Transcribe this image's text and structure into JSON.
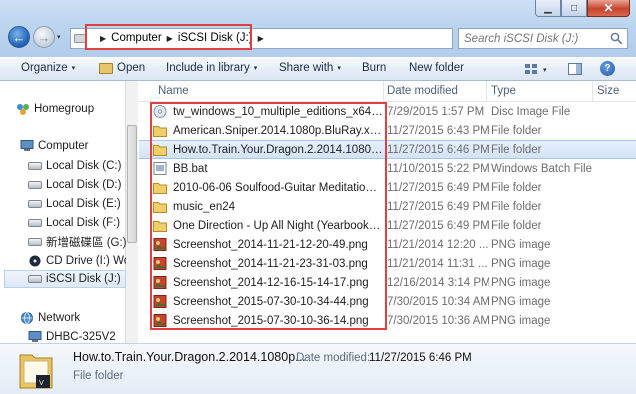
{
  "window": {
    "minimize_glyph": "▁",
    "maximize_glyph": "□",
    "close_glyph": "✕"
  },
  "nav_buttons": {
    "back_glyph": "←",
    "forward_glyph": "→",
    "dropdown_glyph": "▾"
  },
  "address": {
    "crumbs": [
      "Computer",
      "iSCSI Disk (J:)"
    ],
    "separator": "▶",
    "dropdown_glyph": "▾"
  },
  "search": {
    "placeholder": "Search iSCSI Disk (J:)"
  },
  "toolbar": {
    "organize_label": "Organize",
    "open_label": "Open",
    "include_label": "Include in library",
    "share_label": "Share with",
    "burn_label": "Burn",
    "newfolder_label": "New folder",
    "caret": "▾",
    "help_glyph": "?"
  },
  "sidebar": {
    "items": [
      {
        "label": "Homegroup",
        "icon": "homegroup-icon"
      },
      {
        "label": "Computer",
        "icon": "computer-icon"
      },
      {
        "label": "Local Disk (C:)",
        "icon": "drive-icon"
      },
      {
        "label": "Local Disk (D:)",
        "icon": "drive-icon"
      },
      {
        "label": "Local Disk (E:)",
        "icon": "drive-icon"
      },
      {
        "label": "Local Disk (F:)",
        "icon": "drive-icon"
      },
      {
        "label": "新增磁碟區 (G:)",
        "icon": "drive-icon"
      },
      {
        "label": "CD Drive (I:) Wor",
        "icon": "cd-drive-icon"
      },
      {
        "label": "iSCSI Disk (J:)",
        "icon": "drive-icon"
      },
      {
        "label": "Network",
        "icon": "network-icon"
      },
      {
        "label": "DHBC-325V2",
        "icon": "computer-icon"
      }
    ]
  },
  "columns": {
    "name": "Name",
    "date": "Date modified",
    "type": "Type",
    "size": "Size"
  },
  "files": [
    {
      "name": "tw_windows_10_multiple_editions_x64_dvd_...",
      "date": "7/29/2015 1:57 PM",
      "type": "Disc Image File",
      "icon": "disc-image-icon"
    },
    {
      "name": "American.Sniper.2014.1080p.BluRay.x264.DTS",
      "date": "11/27/2015 6:43 PM",
      "type": "File folder",
      "icon": "folder-icon"
    },
    {
      "name": "How.to.Train.Your.Dragon.2.2014.1080p.BluRay",
      "date": "11/27/2015 6:46 PM",
      "type": "File folder",
      "icon": "folder-icon"
    },
    {
      "name": "BB.bat",
      "date": "11/10/2015 5:22 PM",
      "type": "Windows Batch File",
      "icon": "batch-file-icon"
    },
    {
      "name": "2010-06-06 Soulfood-Guitar Meditations...",
      "date": "11/27/2015 6:49 PM",
      "type": "File folder",
      "icon": "folder-icon"
    },
    {
      "name": "music_en24",
      "date": "11/27/2015 6:49 PM",
      "type": "File folder",
      "icon": "folder-icon"
    },
    {
      "name": "One Direction - Up All Night (Yearbook Edition)",
      "date": "11/27/2015 6:49 PM",
      "type": "File folder",
      "icon": "folder-icon"
    },
    {
      "name": "Screenshot_2014-11-21-12-20-49.png",
      "date": "11/21/2014 12:20 ...",
      "type": "PNG image",
      "icon": "png-image-icon"
    },
    {
      "name": "Screenshot_2014-11-21-23-31-03.png",
      "date": "11/21/2014 11:31 ...",
      "type": "PNG image",
      "icon": "png-image-icon"
    },
    {
      "name": "Screenshot_2014-12-16-15-14-17.png",
      "date": "12/16/2014 3:14 PM",
      "type": "PNG image",
      "icon": "png-image-icon"
    },
    {
      "name": "Screenshot_2015-07-30-10-34-44.png",
      "date": "7/30/2015 10:34 AM",
      "type": "PNG image",
      "icon": "png-image-icon"
    },
    {
      "name": "Screenshot_2015-07-30-10-36-14.png",
      "date": "7/30/2015 10:36 AM",
      "type": "PNG image",
      "icon": "png-image-icon"
    }
  ],
  "details": {
    "name": "How.to.Train.Your.Dragon.2.2014.1080p...",
    "date_label": "Date modified:",
    "date_value": "11/27/2015 6:46 PM",
    "type": "File folder"
  },
  "colors": {
    "highlight_red": "#e24040",
    "selection_blue": "#d2e3f7"
  }
}
